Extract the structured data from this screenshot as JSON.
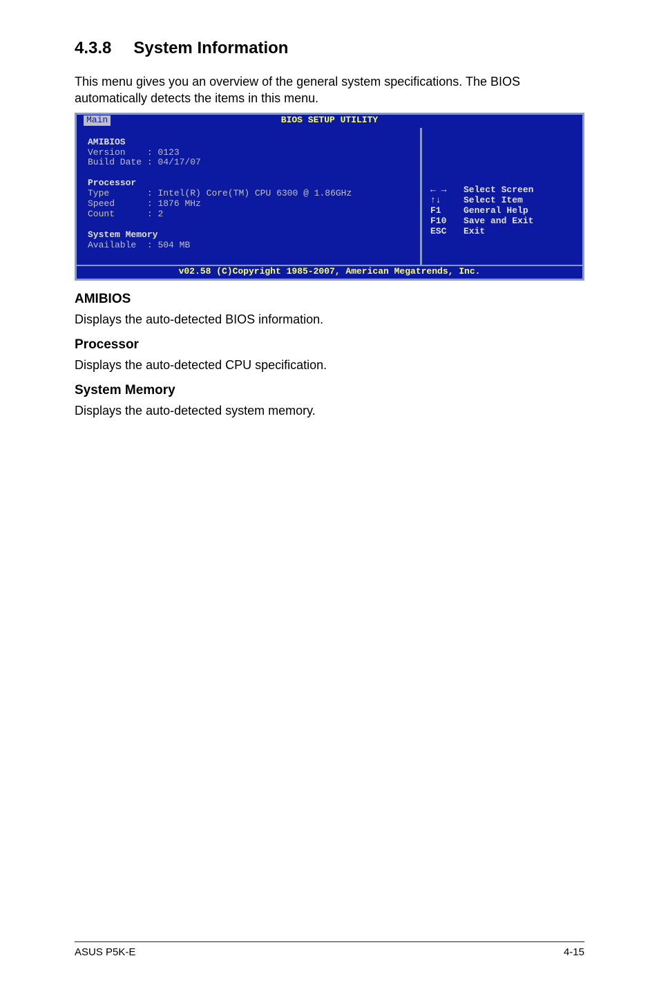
{
  "heading_number": "4.3.8",
  "heading_title": "System Information",
  "intro_text": "This menu gives you an overview of the general system specifications. The BIOS automatically detects the items in this menu.",
  "bios": {
    "title": "BIOS SETUP UTILITY",
    "tab": "Main",
    "amibios": {
      "label": "AMIBIOS",
      "version_label": "Version",
      "version_value": "0123",
      "build_label": "Build Date",
      "build_value": "04/17/07"
    },
    "processor": {
      "label": "Processor",
      "type_label": "Type",
      "type_value": "Intel(R) Core(TM) CPU 6300 @ 1.86GHz",
      "speed_label": "Speed",
      "speed_value": "1876 MHz",
      "count_label": "Count",
      "count_value": "2"
    },
    "memory": {
      "label": "System Memory",
      "available_label": "Available",
      "available_value": "504 MB"
    },
    "nav": {
      "lr_label": "Select Screen",
      "ud_label": "Select Item",
      "f1_key": "F1",
      "f1_label": "General Help",
      "f10_key": "F10",
      "f10_label": "Save and Exit",
      "esc_key": "ESC",
      "esc_label": "Exit"
    },
    "copyright": "v02.58 (C)Copyright 1985-2007, American Megatrends, Inc."
  },
  "sections": {
    "amibios_h": "AMIBIOS",
    "amibios_p": "Displays the auto-detected BIOS information.",
    "processor_h": "Processor",
    "processor_p": "Displays the auto-detected CPU specification.",
    "memory_h": "System Memory",
    "memory_p": "Displays the auto-detected system memory."
  },
  "footer": {
    "left": "ASUS P5K-E",
    "right": "4-15"
  }
}
